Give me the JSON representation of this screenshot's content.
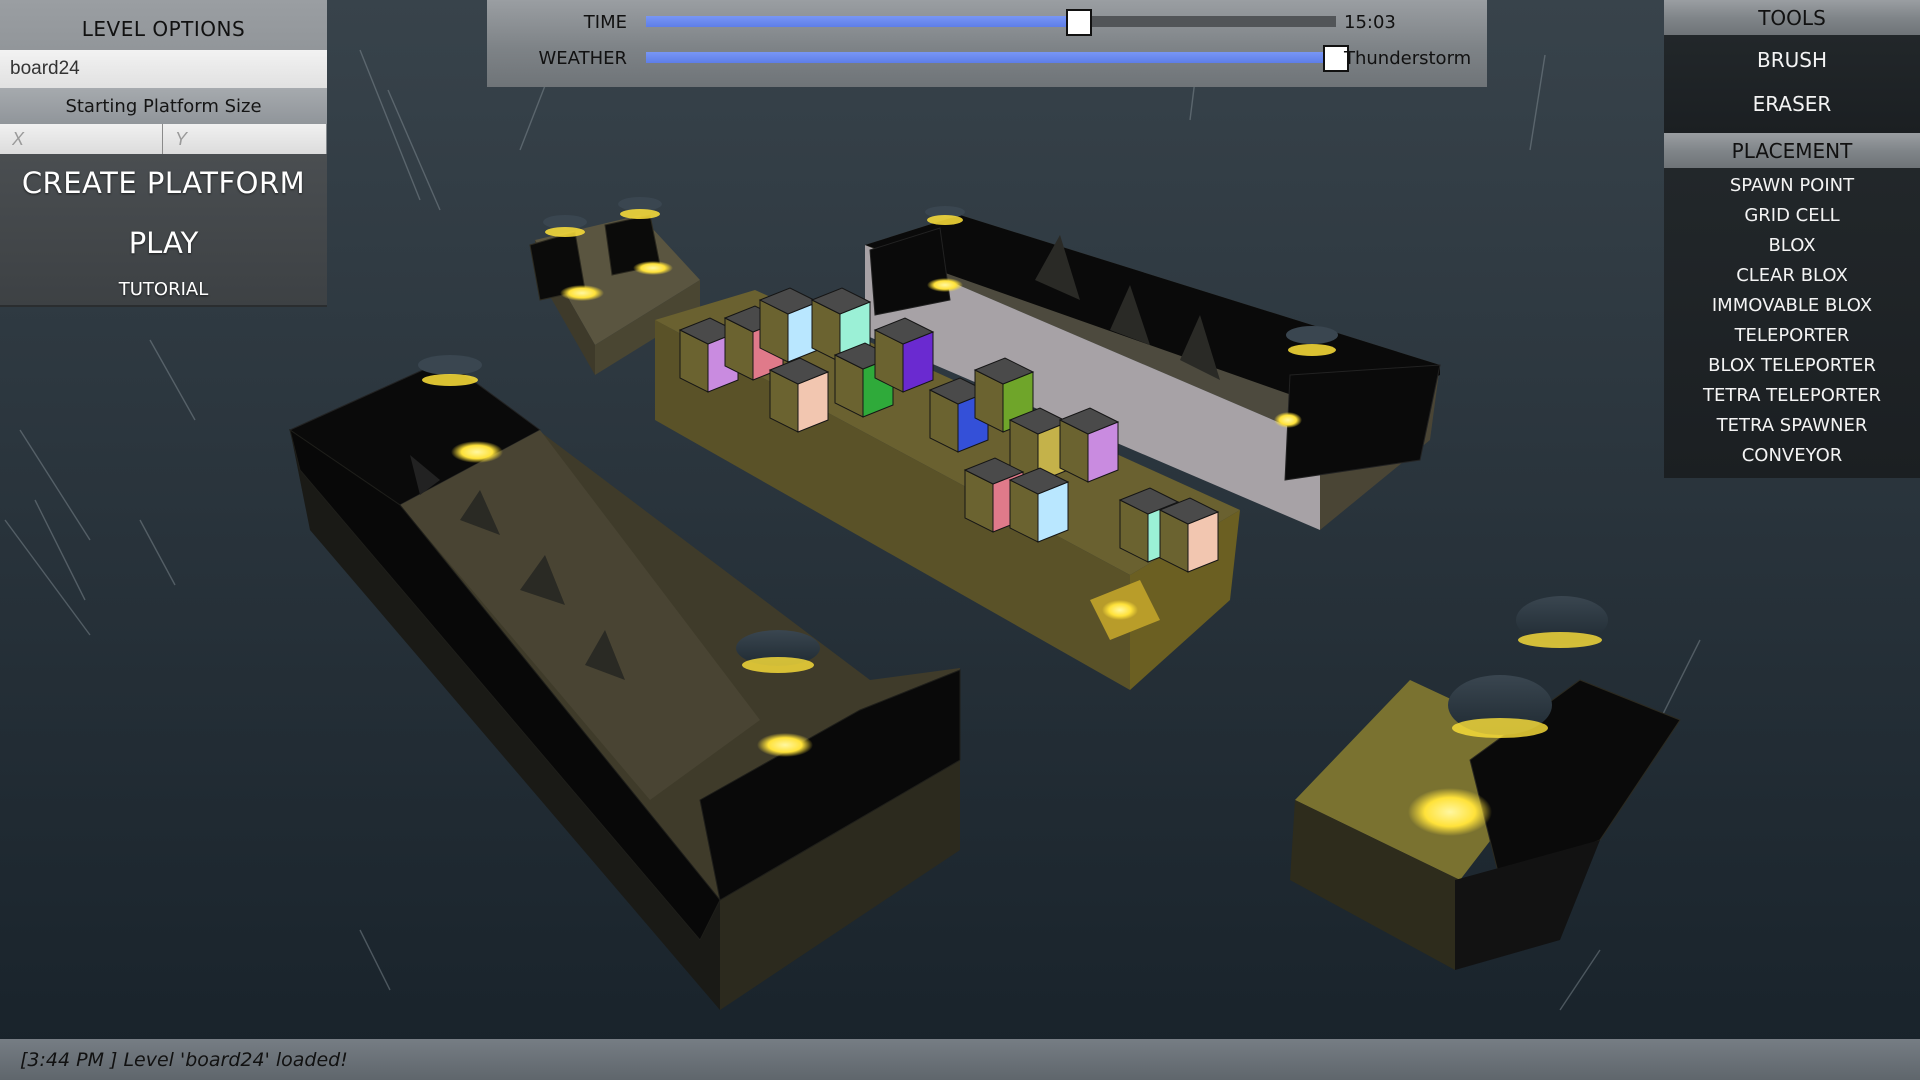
{
  "level_options": {
    "title": "LEVEL OPTIONS",
    "level_name_value": "board24",
    "platform_size_label": "Starting Platform Size",
    "size_x_placeholder": "X",
    "size_y_placeholder": "Y",
    "create_platform_label": "CREATE PLATFORM",
    "play_label": "PLAY",
    "tutorial_label": "TUTORIAL"
  },
  "environment": {
    "time": {
      "label": "TIME",
      "value_text": "15:03",
      "fraction": 0.627
    },
    "weather": {
      "label": "WEATHER",
      "value_text": "Thunderstorm",
      "fraction": 1.0
    },
    "colors": {
      "slider_fill": "#6a88ef",
      "slider_track": "#525558",
      "thumb": "#ffffff"
    }
  },
  "tools": {
    "title": "TOOLS",
    "items": [
      {
        "label": "BRUSH"
      },
      {
        "label": "ERASER"
      }
    ],
    "placement_title": "PLACEMENT",
    "placement_items": [
      {
        "label": "SPAWN POINT"
      },
      {
        "label": "GRID CELL"
      },
      {
        "label": "BLOX"
      },
      {
        "label": "CLEAR BLOX"
      },
      {
        "label": "IMMOVABLE BLOX"
      },
      {
        "label": "TELEPORTER"
      },
      {
        "label": "BLOX TELEPORTER"
      },
      {
        "label": "TETRA TELEPORTER"
      },
      {
        "label": "TETRA SPAWNER"
      },
      {
        "label": "CONVEYOR"
      }
    ]
  },
  "status": {
    "message": "[3:44 PM ] Level 'board24' loaded!"
  },
  "scene": {
    "description": "3D level editor viewport: floating platforms over stormy water with rain",
    "accent_glow": "#ffe23a",
    "blox_colors": [
      "#c98be0",
      "#e07a8a",
      "#b9e7ff",
      "#9bf0d6",
      "#f2c6b0",
      "#2faa3a",
      "#6a2ad0",
      "#3450d8",
      "#6fa52a",
      "#c4b24a"
    ]
  }
}
